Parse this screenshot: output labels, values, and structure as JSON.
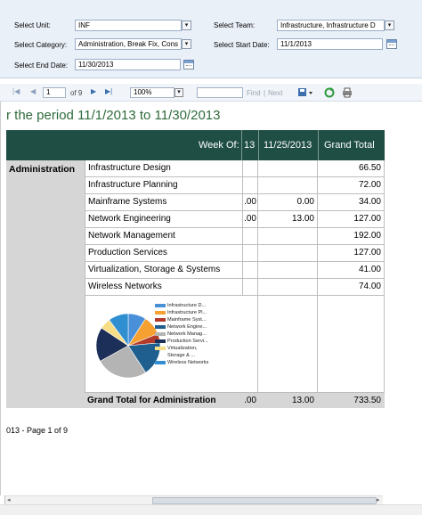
{
  "params": {
    "unit_label": "Select Unit:",
    "unit_value": "INF",
    "team_label": "Select Team:",
    "team_value": "Infrastructure, Infrastructure D",
    "category_label": "Select Category:",
    "category_value": "Administration, Break Fix, Cons",
    "start_date_label": "Select Start Date:",
    "start_date_value": "11/1/2013",
    "end_date_label": "Select End Date:",
    "end_date_value": "11/30/2013"
  },
  "toolbar": {
    "page_current": "1",
    "page_of": "of 9",
    "zoom": "100%",
    "find_label": "Find",
    "separator": "|",
    "next_label": "Next"
  },
  "report": {
    "period_title": "r the period 11/1/2013 to 11/30/2013",
    "header": {
      "week_of": "Week Of:",
      "col_partial": "13",
      "col_date": "11/25/2013",
      "col_total": "Grand Total"
    },
    "group": "Administration",
    "rows": [
      {
        "name": "Infrastructure Design",
        "partial": "",
        "week": "",
        "total": "66.50"
      },
      {
        "name": "Infrastructure Planning",
        "partial": "",
        "week": "",
        "total": "72.00"
      },
      {
        "name": "Mainframe Systems",
        "partial": ".00",
        "week": "0.00",
        "total": "34.00"
      },
      {
        "name": "Network Engineering",
        "partial": ".00",
        "week": "13.00",
        "total": "127.00"
      },
      {
        "name": "Network Management",
        "partial": "",
        "week": "",
        "total": "192.00"
      },
      {
        "name": "Production Services",
        "partial": "",
        "week": "",
        "total": "127.00"
      },
      {
        "name": "Virtualization, Storage & Systems",
        "partial": "",
        "week": "",
        "total": "41.00"
      },
      {
        "name": "Wireless Networks",
        "partial": "",
        "week": "",
        "total": "74.00"
      }
    ],
    "grand_total": {
      "label": "Grand Total for Administration",
      "partial": ".00",
      "week": "13.00",
      "total": "733.50"
    },
    "page_info": "013 - Page 1 of 9"
  },
  "legend": [
    {
      "label": "Infrastructure D...",
      "color": "#4a90d9"
    },
    {
      "label": "Infrastructure Pl...",
      "color": "#f5a030"
    },
    {
      "label": "Mainframe Syst...",
      "color": "#b23a2a"
    },
    {
      "label": "Network Engine...",
      "color": "#1f5f8f"
    },
    {
      "label": "Network Manag...",
      "color": "#b4b4b4"
    },
    {
      "label": "Production Servi...",
      "color": "#1b2f58"
    },
    {
      "label": "Virtualization,",
      "color": "#f7dd86"
    },
    {
      "label": "Storage & ...",
      "color": ""
    },
    {
      "label": "Wireless Networks",
      "color": "#2f8fd0"
    }
  ],
  "pie_values": [
    66.5,
    72,
    34,
    127,
    192,
    127,
    41,
    74
  ]
}
